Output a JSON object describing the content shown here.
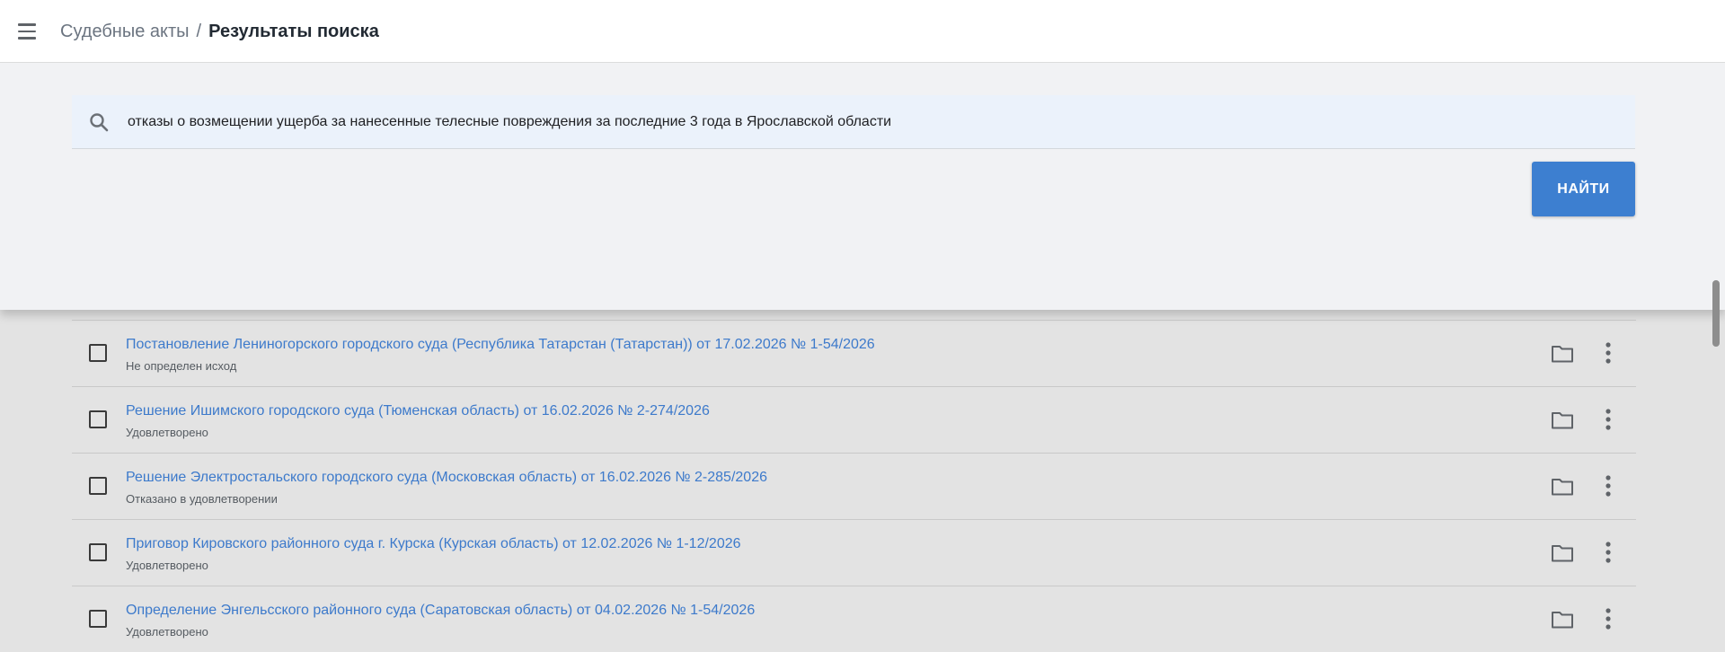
{
  "header": {
    "menu_icon": "hamburger-menu-icon",
    "breadcrumb_parent": "Судебные акты",
    "breadcrumb_separator": "/",
    "breadcrumb_current": "Результаты поиска"
  },
  "search": {
    "icon": "search-icon",
    "value": "отказы о возмещении ущерба за нанесенные телесные повреждения за последние 3 года в Ярославской области",
    "button_label": "НАЙТИ"
  },
  "results": [
    {
      "title": "Постановление Лениногорского городского суда (Республика Татарстан (Татарстан)) от 17.02.2026 № 1-54/2026",
      "status": "Не определен исход"
    },
    {
      "title": "Решение Ишимского городского суда (Тюменская область) от 16.02.2026 № 2-274/2026",
      "status": "Удовлетворено"
    },
    {
      "title": "Решение Электростальского городского суда (Московская область) от 16.02.2026 № 2-285/2026",
      "status": "Отказано в удовлетворении"
    },
    {
      "title": "Приговор Кировского районного суда г. Курска (Курская область) от 12.02.2026 № 1-12/2026",
      "status": "Удовлетворено"
    },
    {
      "title": "Определение Энгельсского районного суда (Саратовская область) от 04.02.2026 № 1-54/2026",
      "status": "Удовлетворено"
    }
  ],
  "colors": {
    "accent": "#3d7fd0",
    "link": "#3d7acb",
    "header_bg": "#ffffff",
    "panel_bg": "#f1f2f4",
    "search_bg": "#ebf2fb",
    "list_bg": "#e3e3e3"
  },
  "row_icons": [
    "folder-icon",
    "more-vertical-icon"
  ]
}
